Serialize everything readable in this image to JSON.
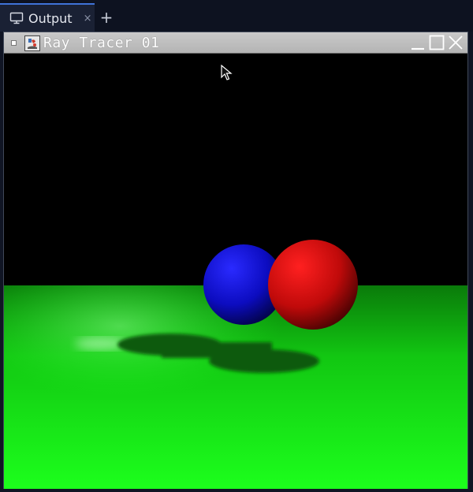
{
  "tabs": [
    {
      "label": "Output",
      "icon": "monitor-icon",
      "close": "×"
    }
  ],
  "new_tab": "+",
  "window": {
    "title": "Ray Tracer 01",
    "icon": "java-app-icon",
    "controls": [
      "minimize-icon",
      "maximize-icon",
      "close-icon"
    ]
  },
  "scene": {
    "background": "#000000",
    "floor_color": "#1aff1a",
    "spheres": [
      {
        "name": "blue-sphere",
        "color": "#1010e0"
      },
      {
        "name": "red-sphere",
        "color": "#e01010"
      }
    ]
  }
}
